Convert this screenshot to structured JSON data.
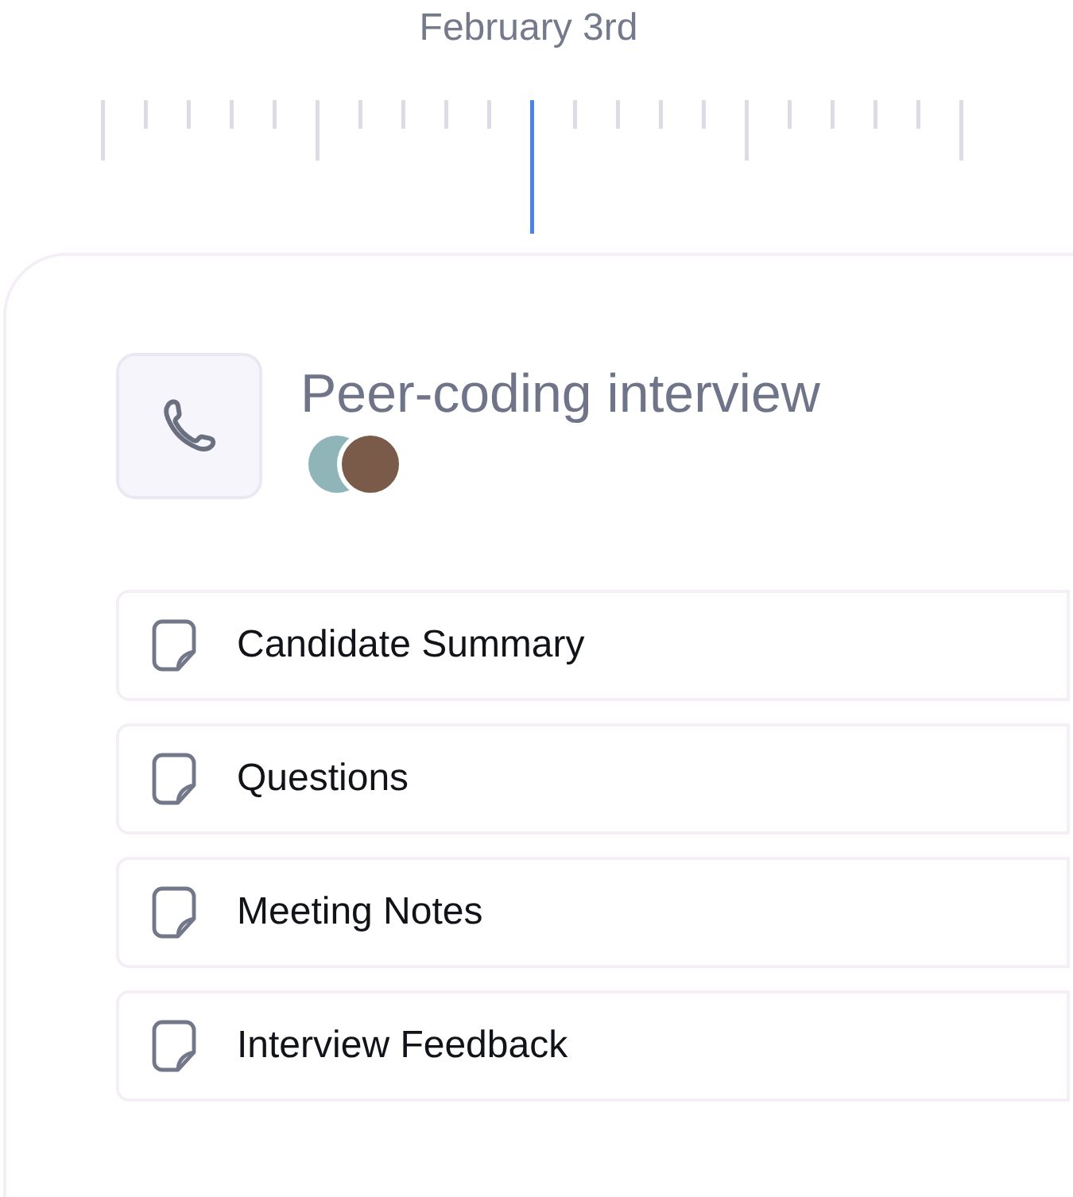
{
  "timeline": {
    "date_label": "February 3rd"
  },
  "event": {
    "title": "Peer-coding interview",
    "documents": [
      {
        "title": "Candidate Summary"
      },
      {
        "title": "Questions"
      },
      {
        "title": "Meeting Notes"
      },
      {
        "title": "Interview Feedback"
      }
    ]
  }
}
